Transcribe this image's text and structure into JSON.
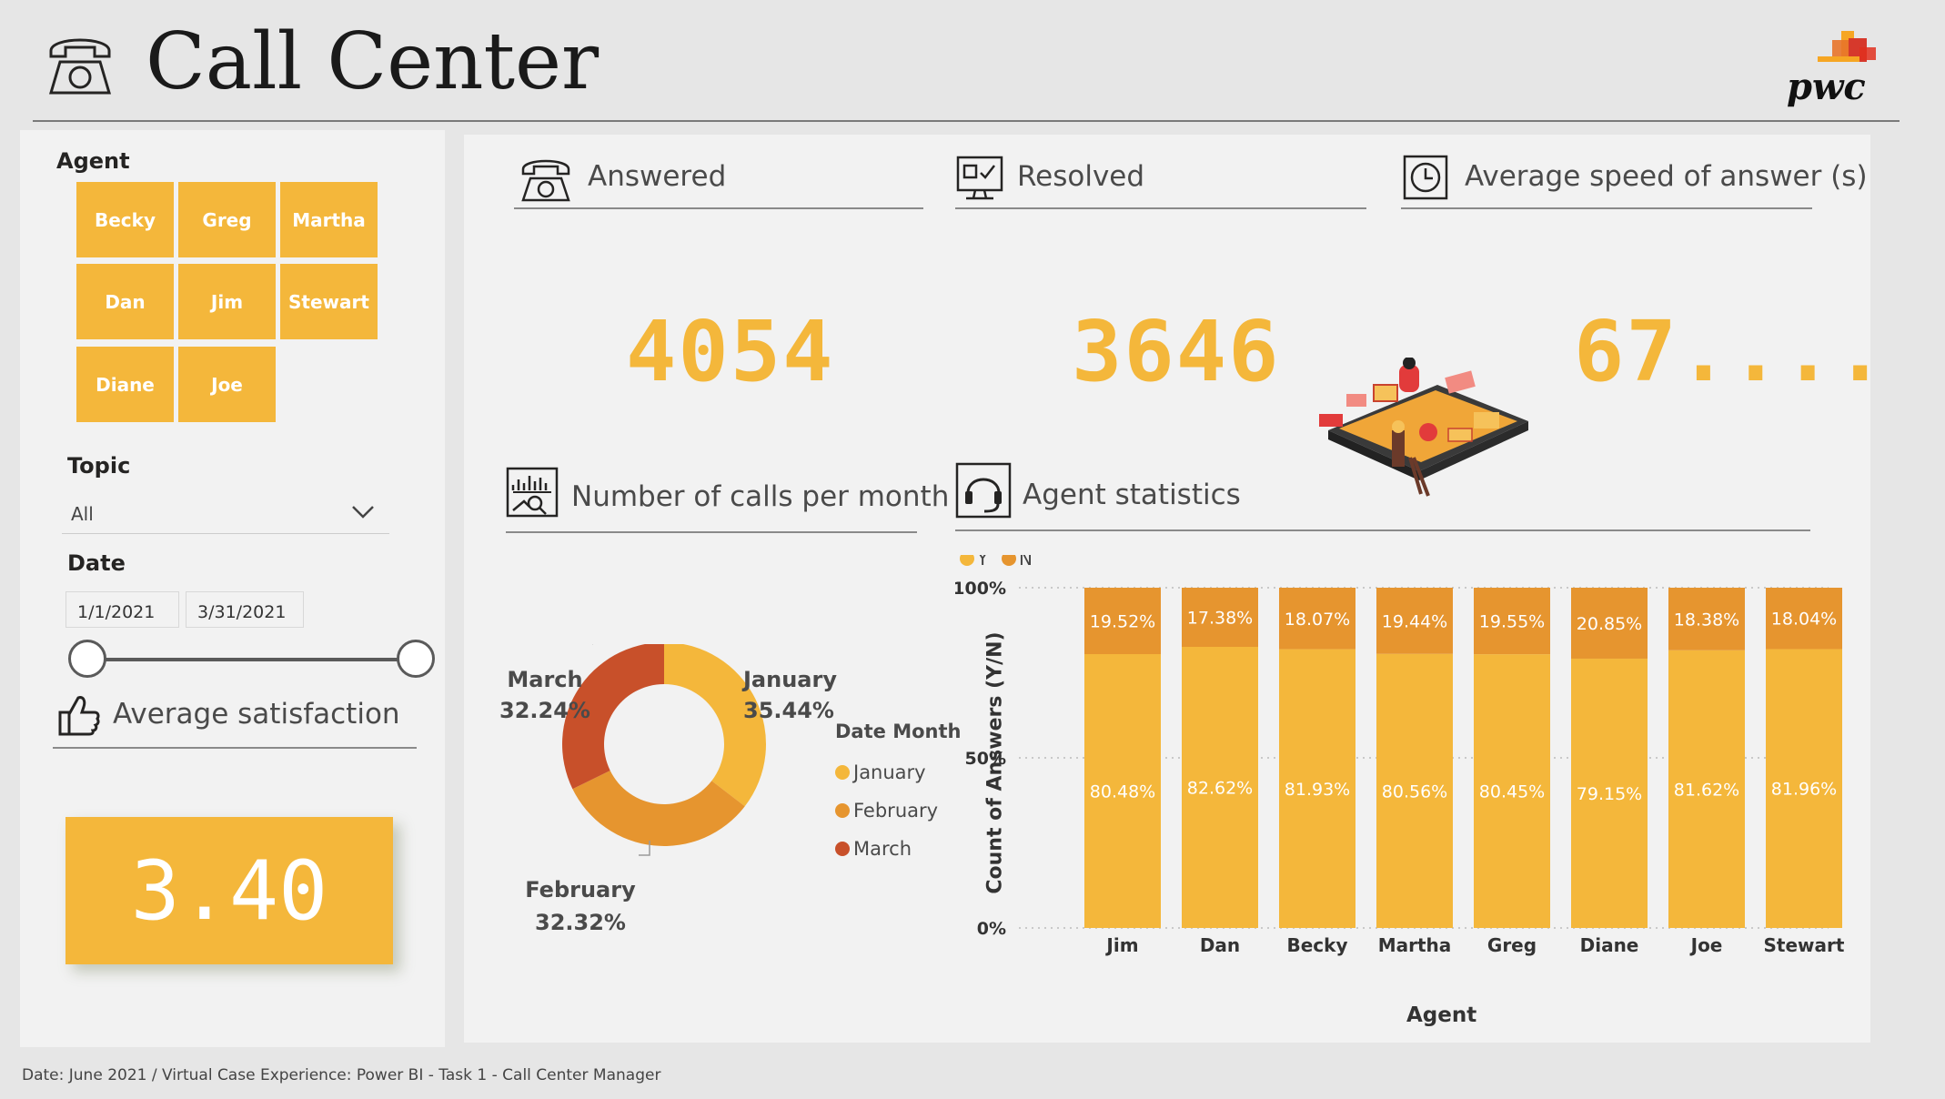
{
  "header": {
    "title": "Call Center",
    "logo_text": "pwc"
  },
  "filters": {
    "agent_label": "Agent",
    "agents": [
      "Becky",
      "Greg",
      "Martha",
      "Dan",
      "Jim",
      "Stewart",
      "Diane",
      "Joe"
    ],
    "topic_label": "Topic",
    "topic_value": "All",
    "date_label": "Date",
    "date_start": "1/1/2021",
    "date_end": "3/31/2021",
    "date_range_fraction": [
      0,
      1
    ]
  },
  "satisfaction": {
    "title": "Average satisfaction",
    "value": "3.40"
  },
  "kpis": {
    "answered": {
      "title": "Answered",
      "value": "4054"
    },
    "resolved": {
      "title": "Resolved",
      "value": "3646"
    },
    "speed": {
      "title": "Average speed of answer (s)",
      "value": "67...."
    }
  },
  "sections": {
    "calls_title": "Number of calls per month",
    "agent_stats_title": "Agent statistics"
  },
  "colors": {
    "accent": "#f4b73b",
    "yes": "#f4b73b",
    "no": "#e6952f",
    "january": "#f4b73b",
    "february": "#e6952f",
    "march": "#c8502a"
  },
  "chart_data": [
    {
      "type": "pie",
      "subtype": "donut",
      "legend_title": "Date Month",
      "categories": [
        "January",
        "February",
        "March"
      ],
      "values": [
        35.44,
        32.32,
        32.24
      ],
      "labels": [
        "35.44%",
        "32.32%",
        "32.24%"
      ],
      "legend_position": "right"
    },
    {
      "type": "bar",
      "stacked": "percent",
      "xlabel": "Agent",
      "ylabel": "Count of Answers (Y/N)",
      "categories": [
        "Jim",
        "Dan",
        "Becky",
        "Martha",
        "Greg",
        "Diane",
        "Joe",
        "Stewart"
      ],
      "series": [
        {
          "name": "Y",
          "values": [
            80.48,
            82.62,
            81.93,
            80.56,
            80.45,
            79.15,
            81.62,
            81.96
          ]
        },
        {
          "name": "N",
          "values": [
            19.52,
            17.38,
            18.07,
            19.44,
            19.55,
            20.85,
            18.38,
            18.04
          ]
        }
      ],
      "yticks": [
        "0%",
        "50%",
        "100%"
      ],
      "ylim": [
        0,
        100
      ],
      "legend_position": "top-left",
      "grid": true
    }
  ],
  "footer": {
    "text": "Date: June 2021 / Virtual Case Experience: Power BI - Task 1 - Call Center Manager"
  }
}
